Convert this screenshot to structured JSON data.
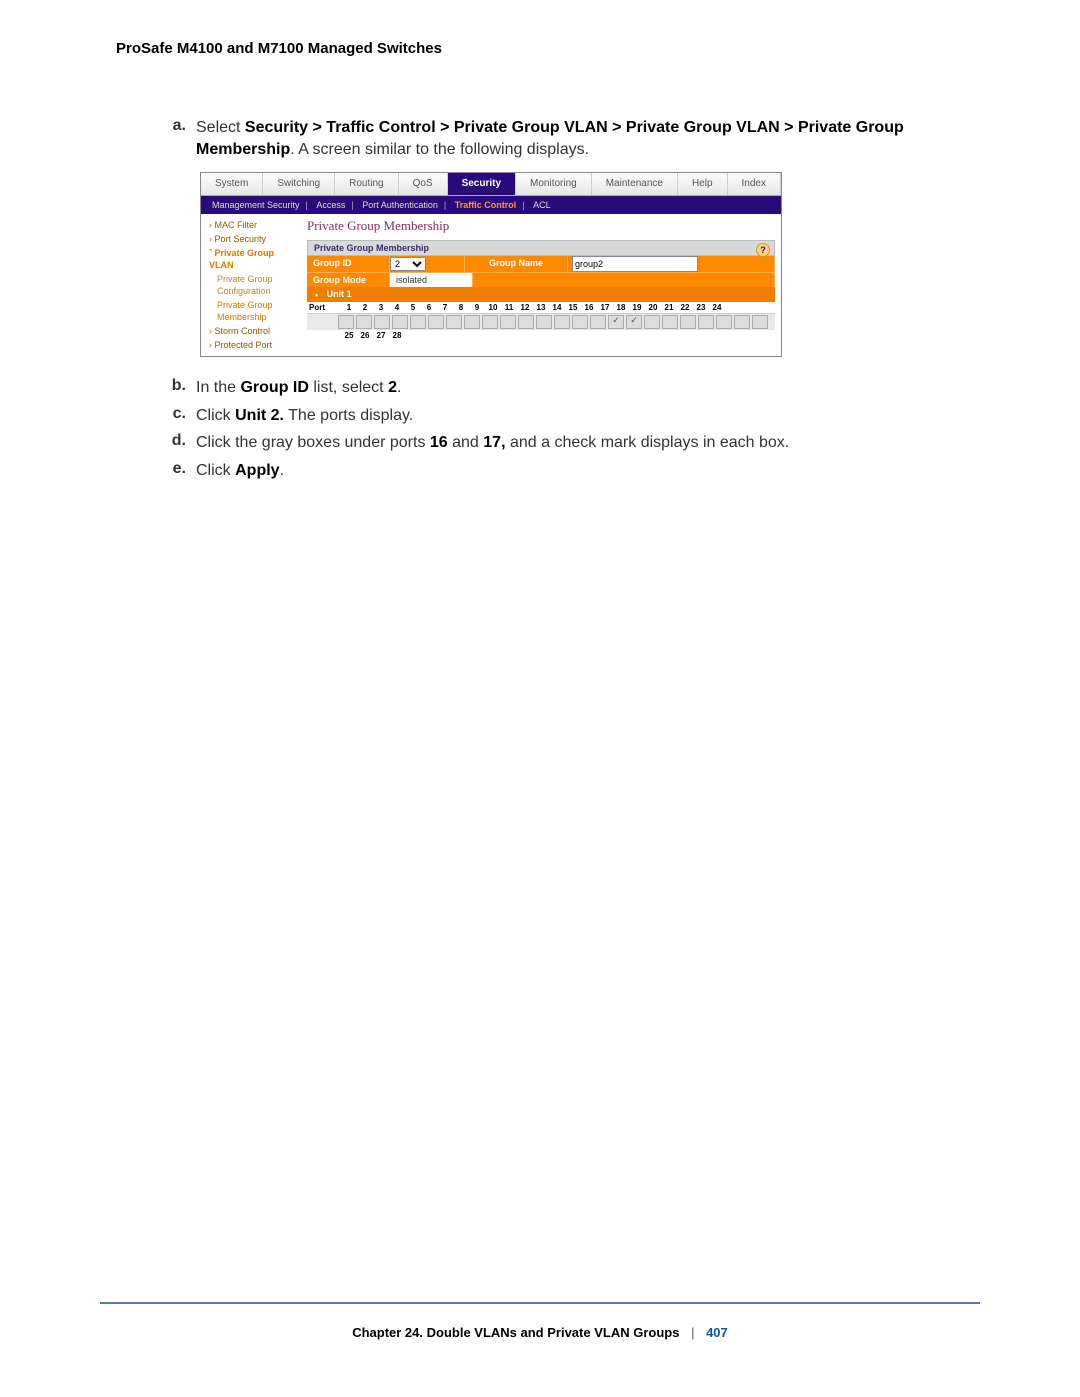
{
  "doc_header": "ProSafe M4100 and M7100 Managed Switches",
  "step_a": {
    "letter": "a.",
    "prefix": "Select ",
    "breadcrumb": "Security > Traffic Control > Private Group VLAN > Private Group VLAN > Private Group Membership",
    "suffix": ". A screen similar to the following displays."
  },
  "step_b": {
    "letter": "b.",
    "t1": "In the ",
    "b1": "Group ID",
    "t2": " list, select ",
    "b2": "2",
    "t3": "."
  },
  "step_c": {
    "letter": "c.",
    "t1": "Click ",
    "b1": "Unit 2.",
    "t2": " The ports display."
  },
  "step_d": {
    "letter": "d.",
    "t1": "Click the gray boxes under ports ",
    "b1": "16",
    "t2": " and ",
    "b2": "17,",
    "t3": " and a check mark displays in each box."
  },
  "step_e": {
    "letter": "e.",
    "t1": "Click ",
    "b1": "Apply",
    "t2": "."
  },
  "tabs": {
    "system": "System",
    "switching": "Switching",
    "routing": "Routing",
    "qos": "QoS",
    "security": "Security",
    "monitoring": "Monitoring",
    "maintenance": "Maintenance",
    "help": "Help",
    "index": "Index"
  },
  "subnav": {
    "mgmt": "Management Security",
    "access": "Access",
    "portauth": "Port Authentication",
    "traffic": "Traffic Control",
    "acl": "ACL"
  },
  "sidebar": {
    "macfilter": "MAC Filter",
    "portsecurity": "Port Security",
    "pgvlan": "Private Group VLAN",
    "pgconfig": "Private Group Configuration",
    "pgmember": "Private Group Membership",
    "stormcontrol": "Storm Control",
    "protectedport": "Protected Port"
  },
  "panel": {
    "title": "Private Group Membership",
    "subtitle": "Private Group Membership",
    "help": "?",
    "groupid_label": "Group ID",
    "groupid_value": "2",
    "groupname_label": "Group Name",
    "groupname_value": "group2",
    "groupmode_label": "Group Mode",
    "groupmode_value": "isolated",
    "unit": "Unit 1",
    "unit_toggle": "•",
    "port_label": "Port",
    "ports_row1": [
      "1",
      "2",
      "3",
      "4",
      "5",
      "6",
      "7",
      "8",
      "9",
      "10",
      "11",
      "12",
      "13",
      "14",
      "15",
      "16",
      "17",
      "18",
      "19",
      "20",
      "21",
      "22",
      "23",
      "24"
    ],
    "ports_row2": [
      "25",
      "26",
      "27",
      "28"
    ],
    "checked_ports": [
      16,
      17
    ]
  },
  "footer": {
    "chapter": "Chapter 24.  Double VLANs and Private VLAN Groups",
    "sep": "|",
    "page": "407"
  }
}
